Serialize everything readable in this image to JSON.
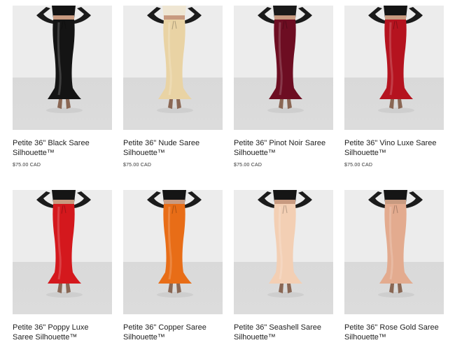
{
  "products": [
    {
      "title": "Petite 36\" Black Saree Silhouette™",
      "price": "$75.00 CAD",
      "color": "#141414",
      "top_color": "#141414",
      "icon": "black-saree-silhouette-photo"
    },
    {
      "title": "Petite 36\" Nude Saree Silhouette™",
      "price": "$75.00 CAD",
      "color": "#e9d3a4",
      "top_color": "#efe6d3",
      "icon": "nude-saree-silhouette-photo"
    },
    {
      "title": "Petite 36\" Pinot Noir Saree Silhouette™",
      "price": "$75.00 CAD",
      "color": "#6d0d22",
      "top_color": "#1a1a1a",
      "icon": "pinot-noir-saree-silhouette-photo"
    },
    {
      "title": "Petite 36\" Vino Luxe Saree Silhouette™",
      "price": "$75.00 CAD",
      "color": "#b5131f",
      "top_color": "#141414",
      "icon": "vino-luxe-saree-silhouette-photo"
    },
    {
      "title": "Petite 36\" Poppy Luxe Saree Silhouette™",
      "price": "",
      "color": "#d4181d",
      "top_color": "#151515",
      "icon": "poppy-luxe-saree-silhouette-photo"
    },
    {
      "title": "Petite 36\" Copper Saree Silhouette™",
      "price": "",
      "color": "#e86d17",
      "top_color": "#151515",
      "icon": "copper-saree-silhouette-photo"
    },
    {
      "title": "Petite 36\" Seashell Saree Silhouette™",
      "price": "",
      "color": "#f3cfb4",
      "top_color": "#151515",
      "icon": "seashell-saree-silhouette-photo"
    },
    {
      "title": "Petite 36\" Rose Gold Saree Silhouette™",
      "price": "",
      "color": "#e3ab8f",
      "top_color": "#151515",
      "icon": "rose-gold-saree-silhouette-photo"
    }
  ]
}
